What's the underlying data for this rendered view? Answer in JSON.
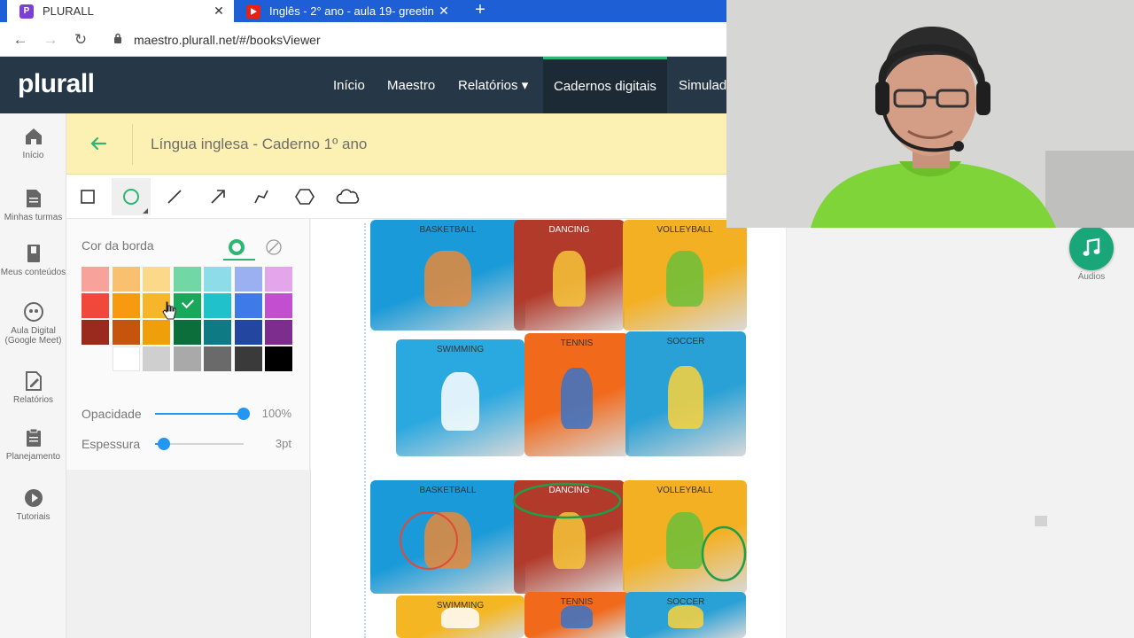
{
  "browser": {
    "tabs": [
      {
        "title": "PLURALL",
        "favicon": "plurall-icon",
        "active": true
      },
      {
        "title": "Inglês - 2° ano - aula 19- greetin",
        "favicon": "youtube-icon",
        "active": false
      }
    ],
    "url": "maestro.plurall.net/#/booksViewer"
  },
  "app": {
    "logo": "plurall",
    "nav": [
      {
        "label": "Início"
      },
      {
        "label": "Maestro"
      },
      {
        "label": "Relatórios ▾"
      },
      {
        "label": "Cadernos digitais"
      },
      {
        "label": "Simulad"
      }
    ]
  },
  "sidebar": {
    "items": [
      {
        "label": "Início",
        "icon": "home-icon"
      },
      {
        "label": "Minhas turmas",
        "icon": "document-icon"
      },
      {
        "label": "Meus conteúdos",
        "icon": "book-icon"
      },
      {
        "label": "Aula Digital (Google Meet)",
        "icon": "quote-icon"
      },
      {
        "label": "Relatórios",
        "icon": "edit-document-icon"
      },
      {
        "label": "Planejamento",
        "icon": "clipboard-icon"
      },
      {
        "label": "Tutoriais",
        "icon": "play-icon"
      }
    ]
  },
  "book": {
    "title": "Língua inglesa - Caderno 1º ano"
  },
  "toolbar": {
    "tools": [
      "rectangle-icon",
      "circle-icon",
      "line-icon",
      "arrow-icon",
      "polyline-icon",
      "hexagon-icon",
      "cloud-icon"
    ],
    "selected": "circle-icon"
  },
  "panel": {
    "border_label": "Cor da borda",
    "opacity_label": "Opacidade",
    "opacity_value": "100%",
    "opacity_level": 1.0,
    "thickness_label": "Espessura",
    "thickness_value": "3pt",
    "thickness_level": 0.1,
    "swatch_rows": [
      [
        "#f7a29a",
        "#f8c06f",
        "#fbd88a",
        "#71d7a5",
        "#8cdde8",
        "#9ab0f0",
        "#e4a6ea"
      ],
      [
        "#f1483c",
        "#f79a10",
        "#f6b52a",
        "#19a75a",
        "#21c1cc",
        "#3e7ae8",
        "#c34ed0"
      ],
      [
        "#9b2a1e",
        "#c6540d",
        "#ee9f0a",
        "#0b6e3b",
        "#0e7a84",
        "#2346a0",
        "#7c2d8e"
      ],
      [
        "",
        "#ffffff",
        "#cfcfcf",
        "#a9a9a9",
        "#6a6a6a",
        "#3a3a3a",
        "#000000"
      ]
    ],
    "selected_swatch": "#19a75a"
  },
  "pages": {
    "panels": [
      {
        "label": "BASKETBALL"
      },
      {
        "label": "DANCING"
      },
      {
        "label": "VOLLEYBALL"
      },
      {
        "label": "SWIMMING"
      },
      {
        "label": "TENNIS"
      },
      {
        "label": "SOCCER"
      },
      {
        "label": "BASKETBALL"
      },
      {
        "label": "DANCING"
      },
      {
        "label": "VOLLEYBALL"
      },
      {
        "label": "SWIMMING"
      },
      {
        "label": "TENNIS"
      },
      {
        "label": "SOCCER"
      }
    ]
  },
  "audio": {
    "label": "Áudios",
    "icon": "music-note-icon"
  }
}
